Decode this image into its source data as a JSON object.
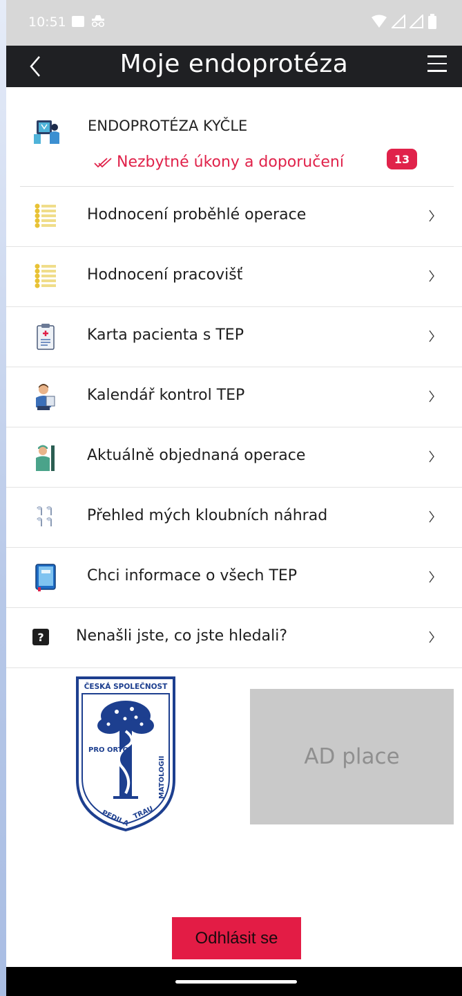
{
  "status_bar": {
    "time": "10:51"
  },
  "header": {
    "title": "Moje endoprotéza"
  },
  "section": {
    "title": "ENDOPROTÉZA KYČLE",
    "must_do_label": "Nezbytné úkony a doporučení",
    "badge_count": "13"
  },
  "menu_items": [
    {
      "label": "Hodnocení proběhlé operace",
      "icon": "list-icon"
    },
    {
      "label": "Hodnocení pracovišť",
      "icon": "list-icon"
    },
    {
      "label": "Karta pacienta s TEP",
      "icon": "clipboard-icon"
    },
    {
      "label": "Kalendář kontrol TEP",
      "icon": "doctor-icon"
    },
    {
      "label": "Aktuálně objednaná operace",
      "icon": "surgeon-icon"
    },
    {
      "label": "Přehled mých kloubních náhrad",
      "icon": "joints-icon"
    },
    {
      "label": "Chci informace o všech TEP",
      "icon": "book-icon"
    },
    {
      "label": "Nenašli jste, co jste hledali?",
      "icon": "question-icon"
    }
  ],
  "logo": {
    "top_text": "ČESKÁ SPOLEČNOST",
    "arc_text": "PRO ORTOPEDII A TRAUMATOLOGII"
  },
  "ad": {
    "text": "AD place"
  },
  "logout_label": "Odhlásit se",
  "colors": {
    "accent": "#e31c45",
    "header_bg": "#1f2023",
    "logo_blue": "#1d3f8f"
  }
}
